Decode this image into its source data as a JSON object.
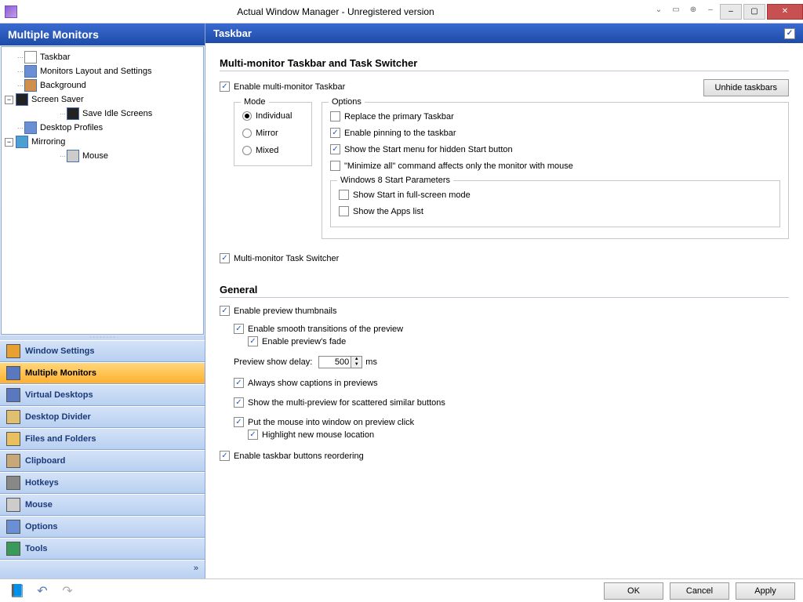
{
  "title": "Actual Window Manager - Unregistered version",
  "sidebar_title": "Multiple Monitors",
  "content_title": "Taskbar",
  "tree": {
    "taskbar": "Taskbar",
    "monitors_layout": "Monitors Layout and Settings",
    "background": "Background",
    "screen_saver": "Screen Saver",
    "save_idle": "Save Idle Screens",
    "desktop_profiles": "Desktop Profiles",
    "mirroring": "Mirroring",
    "mouse": "Mouse"
  },
  "nav": {
    "window_settings": "Window Settings",
    "multiple_monitors": "Multiple Monitors",
    "virtual_desktops": "Virtual Desktops",
    "desktop_divider": "Desktop Divider",
    "files_folders": "Files and Folders",
    "clipboard": "Clipboard",
    "hotkeys": "Hotkeys",
    "mouse": "Mouse",
    "options": "Options",
    "tools": "Tools",
    "expand": "»"
  },
  "section1": {
    "title": "Multi-monitor Taskbar and Task Switcher",
    "enable": "Enable multi-monitor Taskbar",
    "unhide": "Unhide taskbars",
    "mode_legend": "Mode",
    "mode_individual": "Individual",
    "mode_mirror": "Mirror",
    "mode_mixed": "Mixed",
    "options_legend": "Options",
    "opt_replace": "Replace the primary Taskbar",
    "opt_pin": "Enable pinning to the taskbar",
    "opt_start": "Show the Start menu for hidden Start button",
    "opt_minall": "\"Minimize all\" command affects only the monitor with mouse",
    "w8_legend": "Windows 8 Start Parameters",
    "w8_full": "Show Start in full-screen mode",
    "w8_apps": "Show the Apps list",
    "switcher": "Multi-monitor Task Switcher"
  },
  "section2": {
    "title": "General",
    "enable_preview": "Enable preview thumbnails",
    "smooth": "Enable smooth transitions of the preview",
    "fade": "Enable preview's fade",
    "delay_label": "Preview show delay:",
    "delay_value": "500",
    "delay_unit": "ms",
    "captions": "Always show captions in previews",
    "multi_preview": "Show the multi-preview for scattered similar buttons",
    "mouse_into": "Put the mouse into window on preview click",
    "highlight": "Highlight new mouse location",
    "reorder": "Enable taskbar buttons reordering"
  },
  "buttons": {
    "ok": "OK",
    "cancel": "Cancel",
    "apply": "Apply"
  }
}
